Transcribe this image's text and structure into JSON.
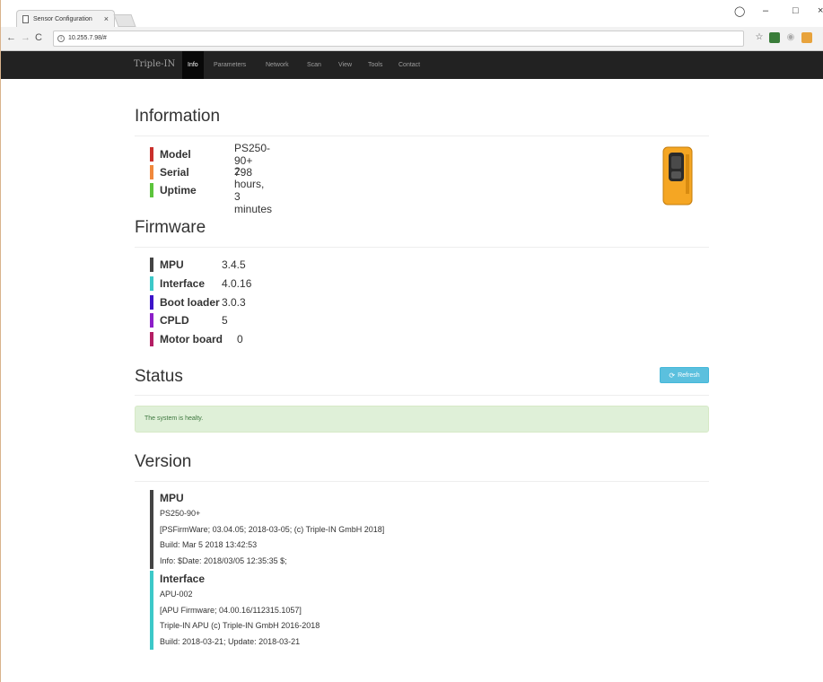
{
  "browser": {
    "tab_title": "Sensor Configuration",
    "tab_close": "×",
    "url": "10.255.7.98/#",
    "controls": {
      "minimize": "–",
      "maximize": "□",
      "close": "×"
    }
  },
  "navbar": {
    "brand": "Triple-IN",
    "items": [
      "Info",
      "Parameters",
      "Network",
      "Scan",
      "View",
      "Tools",
      "Contact"
    ],
    "active": "Info"
  },
  "information": {
    "title": "Information",
    "rows": [
      {
        "label": "Model",
        "value": "PS250-90+",
        "color": "#c9302c"
      },
      {
        "label": "Serial",
        "value": "798",
        "color": "#f0883c"
      },
      {
        "label": "Uptime",
        "value": "2 hours, 3 minutes",
        "color": "#5cc43c"
      }
    ]
  },
  "firmware": {
    "title": "Firmware",
    "rows": [
      {
        "label": "MPU",
        "value": "3.4.5",
        "color": "#444444"
      },
      {
        "label": "Interface",
        "value": "4.0.16",
        "color": "#3cc8c8"
      },
      {
        "label": "Boot loader",
        "value": "3.0.3",
        "color": "#3c14c8"
      },
      {
        "label": "CPLD",
        "value": "5",
        "color": "#8c1ec8"
      },
      {
        "label": "Motor board",
        "value": "0",
        "color": "#b41e64"
      }
    ]
  },
  "status": {
    "title": "Status",
    "refresh_label": "Refresh",
    "message": "The system is healty."
  },
  "version": {
    "title": "Version",
    "blocks": [
      {
        "title": "MPU",
        "color": "#444444",
        "lines": [
          "PS250-90+",
          "[PSFirmWare; 03.04.05; 2018-03-05; (c) Triple-IN GmbH 2018]",
          "Build: Mar 5 2018 13:42:53",
          "Info: $Date: 2018/03/05 12:35:35 $;"
        ]
      },
      {
        "title": "Interface",
        "color": "#3cc8c8",
        "lines": [
          "APU-002",
          "[APU Firmware; 04.00.16/112315.1057]",
          "Triple-IN APU (c) Triple-IN GmbH 2016-2018",
          "Build: 2018-03-21; Update: 2018-03-21"
        ]
      }
    ]
  }
}
